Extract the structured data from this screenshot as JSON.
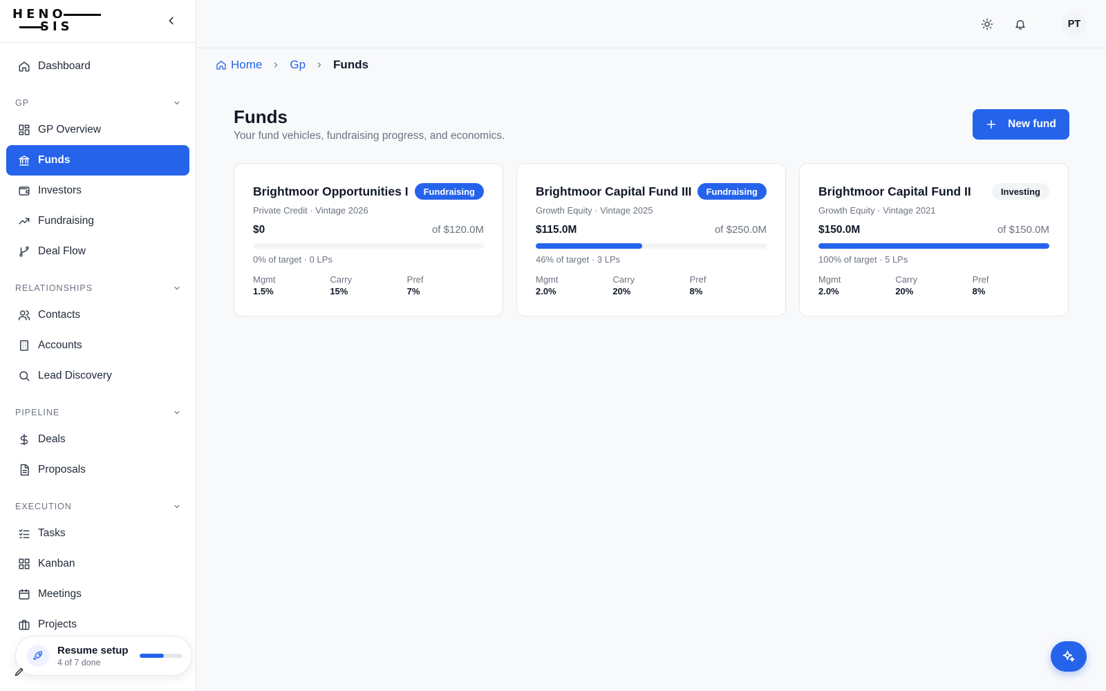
{
  "app": {
    "logo_line1": "HENO",
    "logo_line2": "SIS"
  },
  "sidebar": {
    "dashboard": "Dashboard",
    "sections": [
      {
        "title": "GP",
        "items": [
          "GP Overview",
          "Funds",
          "Investors",
          "Fundraising",
          "Deal Flow"
        ]
      },
      {
        "title": "RELATIONSHIPS",
        "items": [
          "Contacts",
          "Accounts",
          "Lead Discovery"
        ]
      },
      {
        "title": "PIPELINE",
        "items": [
          "Deals",
          "Proposals"
        ]
      },
      {
        "title": "EXECUTION",
        "items": [
          "Tasks",
          "Kanban",
          "Meetings",
          "Projects"
        ]
      }
    ],
    "active_item": "Funds",
    "setup": {
      "title": "Resume setup",
      "progress_text": "4 of 7 done",
      "progress_fraction": 0.57
    }
  },
  "topbar": {
    "avatar_initials": "PT",
    "icons": [
      "sun-icon",
      "bell-icon"
    ]
  },
  "breadcrumb": {
    "home": "Home",
    "gp": "Gp",
    "current": "Funds"
  },
  "page": {
    "title": "Funds",
    "subtitle": "Your fund vehicles, fundraising progress, and economics.",
    "new_button": "New fund"
  },
  "funds": [
    {
      "name": "Brightmoor Opportunities I",
      "status": "Fundraising",
      "meta": "Private Credit · Vintage 2026",
      "raised": "$0",
      "target": "of $120.0M",
      "progress_pct": 0,
      "progress_text": "0% of target · 0 LPs",
      "mgmt_label": "Mgmt",
      "mgmt": "1.5%",
      "carry_label": "Carry",
      "carry": "15%",
      "pref_label": "Pref",
      "pref": "7%"
    },
    {
      "name": "Brightmoor Capital Fund III",
      "status": "Fundraising",
      "meta": "Growth Equity · Vintage 2025",
      "raised": "$115.0M",
      "target": "of $250.0M",
      "progress_pct": 46,
      "progress_text": "46% of target · 3 LPs",
      "mgmt_label": "Mgmt",
      "mgmt": "2.0%",
      "carry_label": "Carry",
      "carry": "20%",
      "pref_label": "Pref",
      "pref": "8%"
    },
    {
      "name": "Brightmoor Capital Fund II",
      "status": "Investing",
      "meta": "Growth Equity · Vintage 2021",
      "raised": "$150.0M",
      "target": "of $150.0M",
      "progress_pct": 100,
      "progress_text": "100% of target · 5 LPs",
      "mgmt_label": "Mgmt",
      "mgmt": "2.0%",
      "carry_label": "Carry",
      "carry": "20%",
      "pref_label": "Pref",
      "pref": "8%"
    }
  ],
  "colors": {
    "accent": "#2563eb",
    "badge_fundraising_bg": "#2563eb",
    "badge_investing_bg": "#f3f4f6"
  }
}
